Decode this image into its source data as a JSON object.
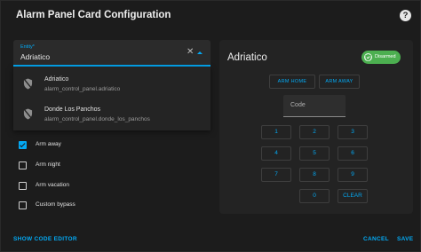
{
  "dialog": {
    "title": "Alarm Panel Card Configuration",
    "help_icon": "help-circle-icon"
  },
  "entity": {
    "label": "Entity*",
    "value": "Adriatico",
    "clear_icon": "close-icon",
    "toggle_icon": "menu-up-icon"
  },
  "dropdown": {
    "options": [
      {
        "name": "Adriatico",
        "entity_id": "alarm_control_panel.adriatico",
        "icon": "shield-off-icon"
      },
      {
        "name": "Donde Los Panchos",
        "entity_id": "alarm_control_panel.donde_los_panchos",
        "icon": "shield-off-icon"
      }
    ]
  },
  "checkboxes": [
    {
      "label": "Arm away",
      "checked": true
    },
    {
      "label": "Arm night",
      "checked": false
    },
    {
      "label": "Arm vacation",
      "checked": false
    },
    {
      "label": "Custom bypass",
      "checked": false
    }
  ],
  "preview": {
    "name": "Adriatico",
    "badge": {
      "label": "Disarmed",
      "icon": "shield-check-icon",
      "color": "#4caf50"
    },
    "actions": [
      "ARM HOME",
      "ARM AWAY"
    ],
    "code_placeholder": "Code",
    "keypad": [
      "1",
      "2",
      "3",
      "4",
      "5",
      "6",
      "7",
      "8",
      "9",
      "0",
      "CLEAR"
    ]
  },
  "footer": {
    "show_code_editor": "SHOW CODE EDITOR",
    "cancel": "CANCEL",
    "save": "SAVE"
  },
  "colors": {
    "accent": "#03a9f4",
    "surface": "#1c1c1c",
    "card": "#232323"
  }
}
